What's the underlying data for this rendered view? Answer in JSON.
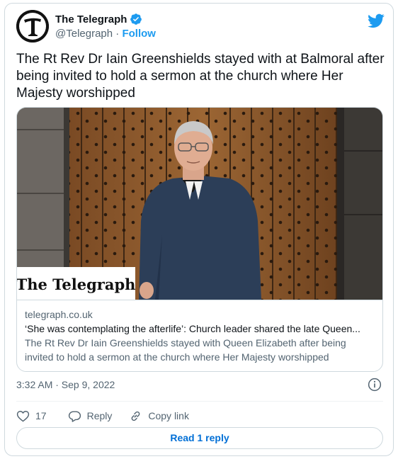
{
  "author": {
    "name": "The Telegraph",
    "handle": "@Telegraph",
    "separator": " · ",
    "follow_label": "Follow"
  },
  "tweet": {
    "text": "The Rt Rev Dr Iain Greenshields stayed with at Balmoral after being invited to hold a sermon at the church where Her Majesty worshipped",
    "timestamp": "3:32 AM · Sep 9, 2022"
  },
  "link_preview": {
    "image_logo_text": "The Telegraph",
    "domain": "telegraph.co.uk",
    "title": "‘She was contemplating the afterlife’: Church leader shared the late Queen...",
    "description": "The Rt Rev Dr Iain Greenshields stayed with Queen Elizabeth after being invited to hold a sermon at the church where Her Majesty worshipped"
  },
  "actions": {
    "like_count": "17",
    "reply_label": "Reply",
    "copy_link_label": "Copy link"
  },
  "read_replies_label": "Read 1 reply",
  "icons": {
    "avatar": "telegraph-logo",
    "verified": "verified-badge-icon",
    "brand": "twitter-bird-icon",
    "info": "info-icon",
    "like": "heart-icon",
    "reply": "reply-bubble-icon",
    "copy": "link-icon"
  },
  "colors": {
    "accent": "#1d9bf0",
    "text": "#0f1419",
    "muted": "#536471",
    "border": "#cfd9de",
    "read_reply": "#006fd6"
  }
}
